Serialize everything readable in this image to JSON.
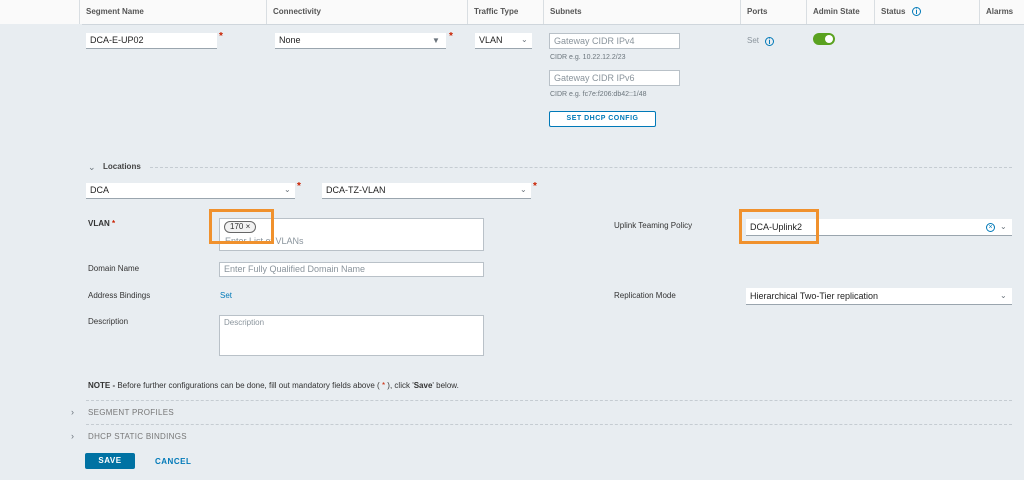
{
  "header": {
    "columns": [
      "Segment Name",
      "Connectivity",
      "Traffic Type",
      "Subnets",
      "Ports",
      "Admin State",
      "Status",
      "Alarms"
    ]
  },
  "segment": {
    "name": "DCA-E-UP02",
    "connectivity": "None",
    "traffic_type": "VLAN",
    "gateway_ipv4_placeholder": "Gateway CIDR IPv4",
    "ipv4_hint": "CIDR e.g. 10.22.12.2/23",
    "gateway_ipv6_placeholder": "Gateway CIDR IPv6",
    "ipv6_hint": "CIDR e.g. fc7e:f206:db42::1/48",
    "dhcp_button": "SET DHCP CONFIG",
    "ports_link": "Set",
    "admin_state_on": true
  },
  "locations": {
    "title": "Locations",
    "location": "DCA",
    "transport_zone": "DCA-TZ-VLAN"
  },
  "form": {
    "vlan_label": "VLAN",
    "vlan_tag": "170",
    "vlan_placeholder": "Enter List of VLANs",
    "uplink_label": "Uplink Teaming Policy",
    "uplink_value": "DCA-Uplink2",
    "domain_label": "Domain Name",
    "domain_placeholder": "Enter Fully Qualified Domain Name",
    "address_label": "Address Bindings",
    "address_link": "Set",
    "replication_label": "Replication Mode",
    "replication_value": "Hierarchical Two-Tier replication",
    "description_label": "Description",
    "description_placeholder": "Description"
  },
  "note": {
    "prefix": "NOTE - ",
    "text_before": "Before further configurations can be done, fill out mandatory fields above ( ",
    "star": "*",
    "text_mid": " ), click '",
    "save_word": "Save",
    "text_after": "' below."
  },
  "sections": {
    "segment_profiles": "SEGMENT PROFILES",
    "dhcp_static": "DHCP STATIC BINDINGS"
  },
  "actions": {
    "save": "SAVE",
    "cancel": "CANCEL"
  },
  "colors": {
    "accent": "#0079b8",
    "primary_button": "#0072a3",
    "toggle_on": "#5aa220",
    "highlight": "#f0912d",
    "required": "#c92100"
  }
}
